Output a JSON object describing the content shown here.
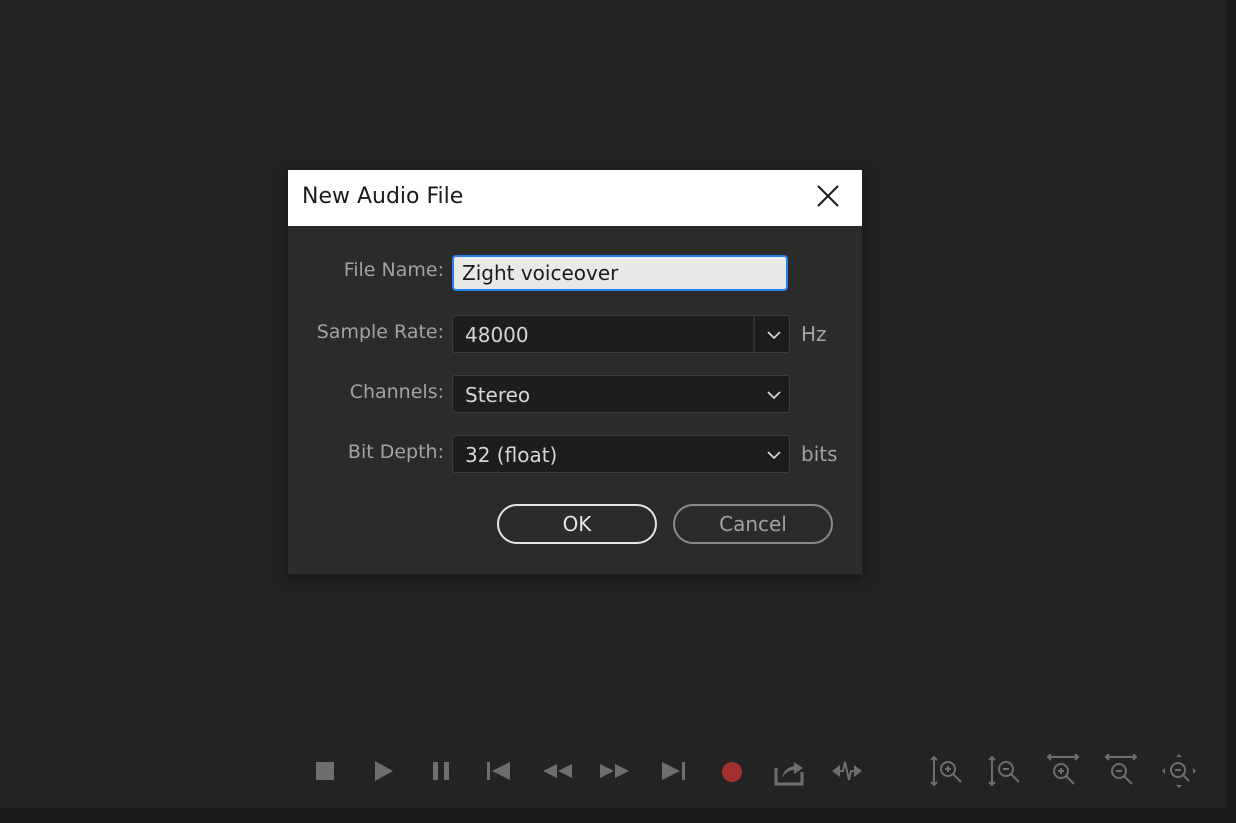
{
  "dialog": {
    "title": "New Audio File",
    "fields": {
      "file_name": {
        "label": "File Name:",
        "value": "Zight voiceover"
      },
      "sample_rate": {
        "label": "Sample Rate:",
        "value": "48000",
        "unit": "Hz"
      },
      "channels": {
        "label": "Channels:",
        "value": "Stereo"
      },
      "bit_depth": {
        "label": "Bit Depth:",
        "value": "32 (float)",
        "unit": "bits"
      }
    },
    "buttons": {
      "ok": "OK",
      "cancel": "Cancel"
    }
  },
  "toolbar": {
    "icons": [
      "stop-icon",
      "play-icon",
      "pause-icon",
      "skip-to-start-icon",
      "rewind-icon",
      "fast-forward-icon",
      "skip-to-end-icon",
      "record-icon",
      "export-icon",
      "skip-silence-icon",
      "zoom-in-vertical-icon",
      "zoom-out-vertical-icon",
      "zoom-in-horizontal-icon",
      "zoom-out-horizontal-icon",
      "zoom-fit-icon"
    ]
  },
  "colors": {
    "accent": "#2680eb",
    "record": "#a33030",
    "background": "#232323",
    "dialog": "#2b2b2b"
  }
}
